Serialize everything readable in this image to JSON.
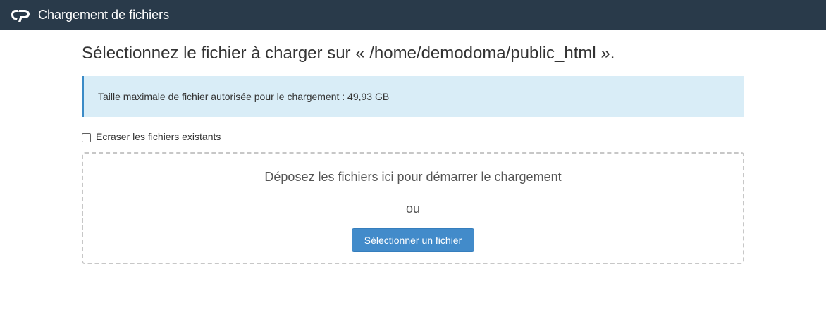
{
  "header": {
    "logo_icon": "cpanel-logo-icon",
    "title": "Chargement de fichiers",
    "background_color": "#293a4a"
  },
  "main": {
    "heading": "Sélectionnez le fichier à charger sur « /home/demodoma/public_html ».",
    "info": {
      "text": "Taille maximale de fichier autorisée pour le chargement : 49,93 GB",
      "background_color": "#d9edf7",
      "accent_color": "#3b8bc7"
    },
    "overwrite": {
      "label": "Écraser les fichiers existants",
      "checked": false
    },
    "dropzone": {
      "drop_text": "Déposez les fichiers ici pour démarrer le chargement",
      "or_text": "ou",
      "button_label": "Sélectionner un fichier",
      "button_color": "#428bca"
    }
  }
}
